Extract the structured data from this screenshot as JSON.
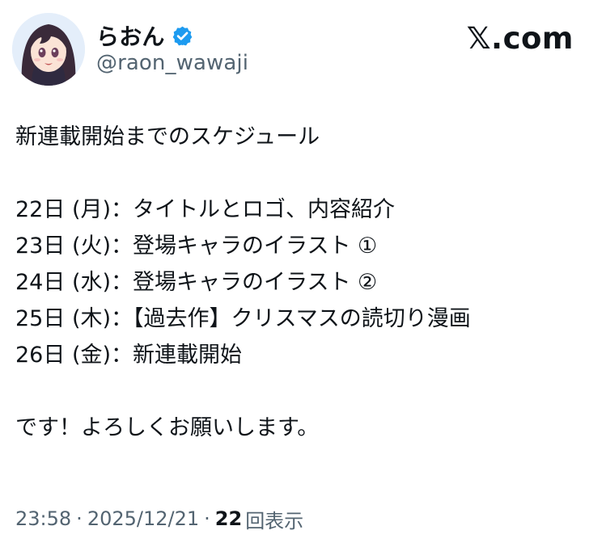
{
  "author": {
    "display_name": "らおん",
    "handle": "@raon_wawaji",
    "verified": true,
    "avatar_icon": "anime-girl-avatar-icon",
    "verified_color": "#1d9bf0"
  },
  "brand": {
    "logo_text": "𝕏.com",
    "logo_icon": "x-logo-icon"
  },
  "tweet": {
    "text": "新連載開始までのスケジュール\n\n22日 (月)：タイトルとロゴ、内容紹介\n23日 (火)：登場キャラのイラスト ①\n24日 (水)：登場キャラのイラスト ②\n25日 (木)：【過去作】クリスマスの読切り漫画\n26日 (金)：新連載開始\n\nです！よろしくお願いします。"
  },
  "meta": {
    "time": "23:58",
    "separator": "·",
    "date": "2025/12/21",
    "views_count": "22",
    "views_label": "回表示"
  },
  "colors": {
    "text": "#0f1419",
    "secondary_text": "#536471",
    "background": "#ffffff"
  }
}
